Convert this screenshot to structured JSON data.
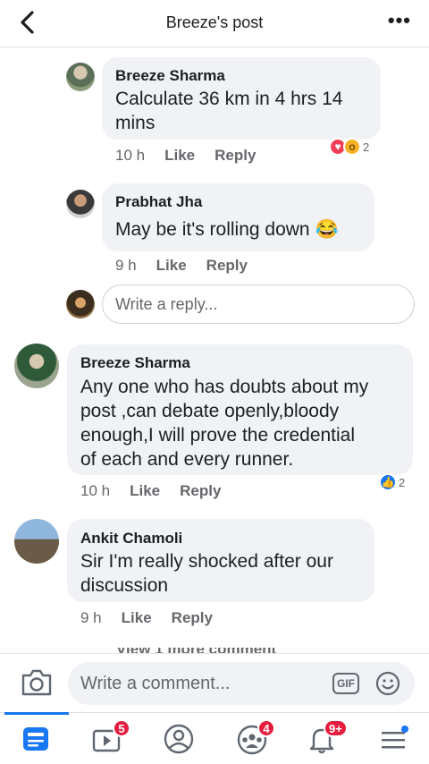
{
  "header": {
    "title": "Breeze's post",
    "more": "•••"
  },
  "comments": [
    {
      "author": "Breeze Sharma",
      "lines": [
        "Calculate 36 km in 4 hrs 14",
        "mins"
      ],
      "time": "10 h",
      "like": "Like",
      "reply": "Reply",
      "reaction_count": "2",
      "reaction_icons": [
        "heart-icon",
        "wow-icon"
      ]
    },
    {
      "author": "Prabhat Jha",
      "lines": [
        "May be it's rolling down 😂"
      ],
      "time": "9 h",
      "like": "Like",
      "reply": "Reply"
    },
    {
      "author": "Breeze Sharma",
      "lines": [
        "Any one who has doubts about my",
        "post ,can debate openly,bloody",
        "enough,I will prove the credential",
        "of each and every runner."
      ],
      "time": "10 h",
      "like": "Like",
      "reply": "Reply",
      "reaction_count": "2",
      "reaction_icons": [
        "like-icon"
      ]
    },
    {
      "author": "Ankit Chamoli",
      "lines": [
        "Sir I'm really shocked after our",
        "discussion"
      ],
      "time": "9 h",
      "like": "Like",
      "reply": "Reply"
    }
  ],
  "reply_input": {
    "placeholder": "Write a reply..."
  },
  "partial_text": "View 1 more comment",
  "composer": {
    "placeholder": "Write a comment...",
    "gif": "GIF"
  },
  "tabs": [
    {
      "name": "news-feed",
      "badge": ""
    },
    {
      "name": "watch",
      "badge": "5"
    },
    {
      "name": "profile",
      "badge": ""
    },
    {
      "name": "groups",
      "badge": "4"
    },
    {
      "name": "notifications",
      "badge": "9+"
    },
    {
      "name": "menu",
      "badge": ""
    }
  ],
  "colors": {
    "accent": "#1877f2",
    "badge": "#e41e3f",
    "bubble": "#f0f2f5"
  }
}
